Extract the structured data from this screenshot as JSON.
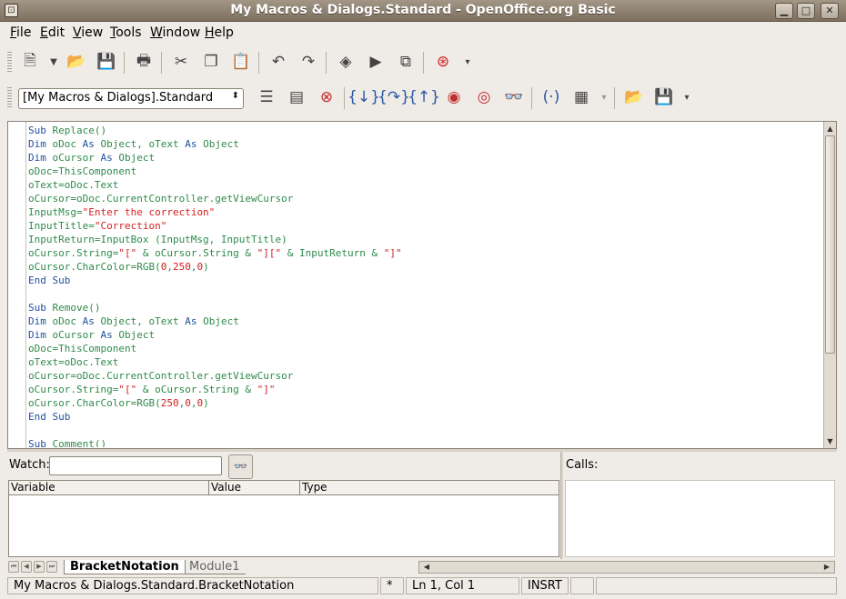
{
  "window": {
    "title": "My Macros & Dialogs.Standard - OpenOffice.org Basic",
    "controls": {
      "minimize": "▁",
      "maximize": "□",
      "close": "✕"
    }
  },
  "menu": [
    {
      "label": "File",
      "underline": "F",
      "rest": "ile"
    },
    {
      "label": "Edit",
      "underline": "E",
      "rest": "dit"
    },
    {
      "label": "View",
      "underline": "V",
      "rest": "iew"
    },
    {
      "label": "Tools",
      "underline": "T",
      "rest": "ools"
    },
    {
      "label": "Window",
      "underline": "W",
      "rest": "indow"
    },
    {
      "label": "Help",
      "underline": "H",
      "rest": "elp"
    }
  ],
  "standard_toolbar": {
    "icons": [
      "new-document-icon",
      "dropdown-arrow-icon",
      "open-folder-icon",
      "save-icon",
      "print-icon",
      "cut-icon",
      "copy-icon",
      "paste-icon",
      "undo-icon",
      "redo-icon",
      "macro-organizer-icon",
      "run-icon",
      "basic-ide-icon",
      "help-icon",
      "toolbar-overflow-icon"
    ]
  },
  "macro_toolbar": {
    "library_select": "[My Macros & Dialogs].Standard",
    "icons": [
      "compile-icon",
      "run-basic-icon",
      "stop-icon",
      "step-into-icon",
      "step-over-icon",
      "step-out-icon",
      "breakpoint-icon",
      "manage-breakpoints-icon",
      "watch-icon",
      "find-parentheses-icon",
      "insert-controls-icon",
      "import-dialog-icon",
      "save-source-icon",
      "toolbar-overflow-icon"
    ]
  },
  "code_lines": [
    [
      [
        "kw",
        "Sub "
      ],
      [
        "op",
        "Replace()"
      ]
    ],
    [
      [
        "kw",
        "Dim "
      ],
      [
        "op",
        "oDoc "
      ],
      [
        "kw",
        "As "
      ],
      [
        "op",
        "Object, oText "
      ],
      [
        "kw",
        "As "
      ],
      [
        "op",
        "Object"
      ]
    ],
    [
      [
        "kw",
        "Dim "
      ],
      [
        "op",
        "oCursor "
      ],
      [
        "kw",
        "As "
      ],
      [
        "op",
        "Object"
      ]
    ],
    [
      [
        "op",
        "oDoc=ThisComponent"
      ]
    ],
    [
      [
        "op",
        "oText=oDoc.Text"
      ]
    ],
    [
      [
        "op",
        "oCursor=oDoc.CurrentController.getViewCursor"
      ]
    ],
    [
      [
        "op",
        "InputMsg="
      ],
      [
        "str",
        "\"Enter the correction\""
      ]
    ],
    [
      [
        "op",
        "InputTitle="
      ],
      [
        "str",
        "\"Correction\""
      ]
    ],
    [
      [
        "op",
        "InputReturn=InputBox (InputMsg, InputTitle)"
      ]
    ],
    [
      [
        "op",
        "oCursor.String="
      ],
      [
        "str",
        "\"[\""
      ],
      [
        "op",
        " & oCursor.String & "
      ],
      [
        "str",
        "\"][\""
      ],
      [
        "op",
        " & InputReturn & "
      ],
      [
        "str",
        "\"]\""
      ]
    ],
    [
      [
        "op",
        "oCursor.CharColor=RGB("
      ],
      [
        "num",
        "0"
      ],
      [
        "op",
        ","
      ],
      [
        "num",
        "250"
      ],
      [
        "op",
        ","
      ],
      [
        "num",
        "0"
      ],
      [
        "op",
        ")"
      ]
    ],
    [
      [
        "kw",
        "End Sub"
      ]
    ],
    [],
    [
      [
        "kw",
        "Sub "
      ],
      [
        "op",
        "Remove()"
      ]
    ],
    [
      [
        "kw",
        "Dim "
      ],
      [
        "op",
        "oDoc "
      ],
      [
        "kw",
        "As "
      ],
      [
        "op",
        "Object, oText "
      ],
      [
        "kw",
        "As "
      ],
      [
        "op",
        "Object"
      ]
    ],
    [
      [
        "kw",
        "Dim "
      ],
      [
        "op",
        "oCursor "
      ],
      [
        "kw",
        "As "
      ],
      [
        "op",
        "Object"
      ]
    ],
    [
      [
        "op",
        "oDoc=ThisComponent"
      ]
    ],
    [
      [
        "op",
        "oText=oDoc.Text"
      ]
    ],
    [
      [
        "op",
        "oCursor=oDoc.CurrentController.getViewCursor"
      ]
    ],
    [
      [
        "op",
        "oCursor.String="
      ],
      [
        "str",
        "\"[\""
      ],
      [
        "op",
        " & oCursor.String & "
      ],
      [
        "str",
        "\"]\""
      ]
    ],
    [
      [
        "op",
        "oCursor.CharColor=RGB("
      ],
      [
        "num",
        "250"
      ],
      [
        "op",
        ","
      ],
      [
        "num",
        "0"
      ],
      [
        "op",
        ","
      ],
      [
        "num",
        "0"
      ],
      [
        "op",
        ")"
      ]
    ],
    [
      [
        "kw",
        "End Sub"
      ]
    ],
    [],
    [
      [
        "kw",
        "Sub "
      ],
      [
        "op",
        "Comment()"
      ]
    ]
  ],
  "watch": {
    "label": "Watch:",
    "value": "",
    "columns": [
      "Variable",
      "Value",
      "Type"
    ]
  },
  "calls": {
    "label": "Calls:"
  },
  "tabs": [
    {
      "label": "BracketNotation",
      "active": true
    },
    {
      "label": "Module1",
      "active": false
    }
  ],
  "status": {
    "location": "My Macros & Dialogs.Standard.BracketNotation",
    "modified": "*",
    "position": "Ln 1, Col 1",
    "mode": "INSRT"
  }
}
